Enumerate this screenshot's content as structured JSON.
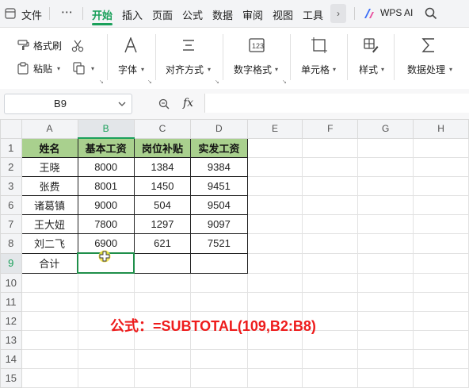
{
  "menubar": {
    "file": "文件",
    "more_dots": "⋯",
    "tabs": [
      "开始",
      "插入",
      "页面",
      "公式",
      "数据",
      "审阅",
      "视图",
      "工具"
    ],
    "more_arrow": "›",
    "wps_ai": "WPS AI"
  },
  "ribbon": {
    "format_painter": "格式刷",
    "paste": "粘贴",
    "font": "字体",
    "align": "对齐方式",
    "number_format": "数字格式",
    "cell": "单元格",
    "style": "样式",
    "data_process": "数据处理"
  },
  "formula_bar": {
    "name_box": "B9",
    "fx": "fx",
    "content": ""
  },
  "sheet": {
    "columns": [
      "A",
      "B",
      "C",
      "D",
      "E",
      "F",
      "G",
      "H"
    ],
    "row_numbers": [
      "1",
      "2",
      "3",
      "6",
      "7",
      "8",
      "9",
      "10",
      "11",
      "12",
      "13",
      "14",
      "15"
    ],
    "header": [
      "姓名",
      "基本工资",
      "岗位补贴",
      "实发工资"
    ],
    "rows": [
      [
        "王晓",
        "8000",
        "1384",
        "9384"
      ],
      [
        "张费",
        "8001",
        "1450",
        "9451"
      ],
      [
        "诸葛镇",
        "9000",
        "504",
        "9504"
      ],
      [
        "王大妞",
        "7800",
        "1297",
        "9097"
      ],
      [
        "刘二飞",
        "6900",
        "621",
        "7521"
      ]
    ],
    "total_label": "合计",
    "selected_cell": "B9"
  },
  "annotation": "公式：=SUBTOTAL(109,B2:B8)",
  "colors": {
    "accent": "#1aa05a",
    "header_fill": "#a9d08e",
    "note_red": "#ee1c1c"
  }
}
